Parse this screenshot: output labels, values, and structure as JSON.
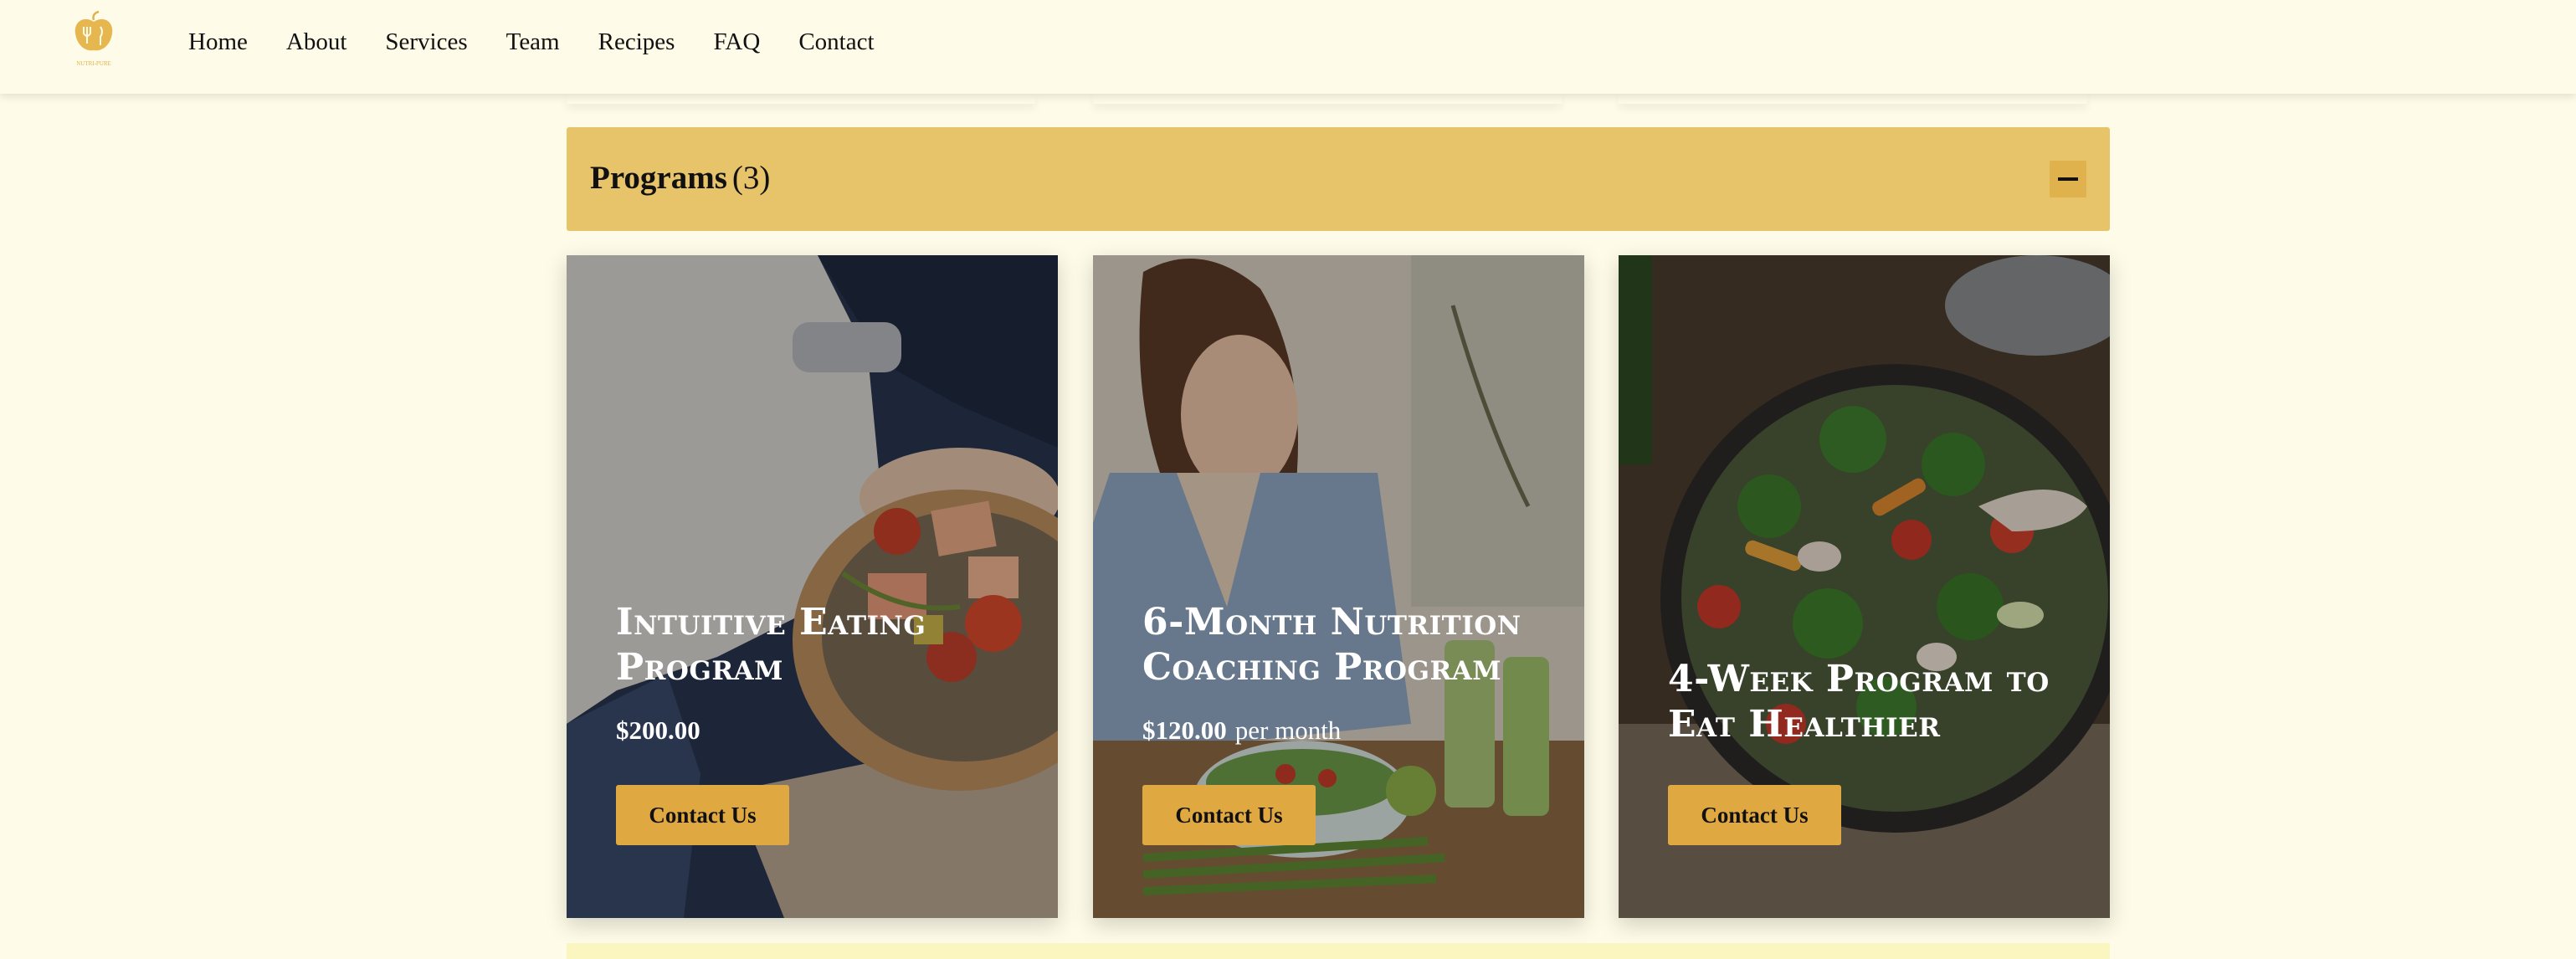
{
  "header": {
    "logo_text": "NUTRI-PURE",
    "nav": [
      "Home",
      "About",
      "Services",
      "Team",
      "Recipes",
      "FAQ",
      "Contact"
    ]
  },
  "accordion": {
    "title": "Programs",
    "count": "(3)",
    "toggle_icon": "minus-icon"
  },
  "programs": [
    {
      "title": "Intuitive Eating Program",
      "price": "$200.00",
      "period": "",
      "button": "Contact Us"
    },
    {
      "title": "6-Month Nutrition Coaching Program",
      "price": "$120.00",
      "period": "per month",
      "button": "Contact Us"
    },
    {
      "title": "4-Week Program to Eat Healthier",
      "price": "",
      "period": "",
      "button": "Contact Us"
    }
  ],
  "colors": {
    "page_bg": "#fefce8",
    "accordion_bg": "#e7c36a",
    "button_bg": "#e0a840",
    "logo": "#dfb24e"
  }
}
